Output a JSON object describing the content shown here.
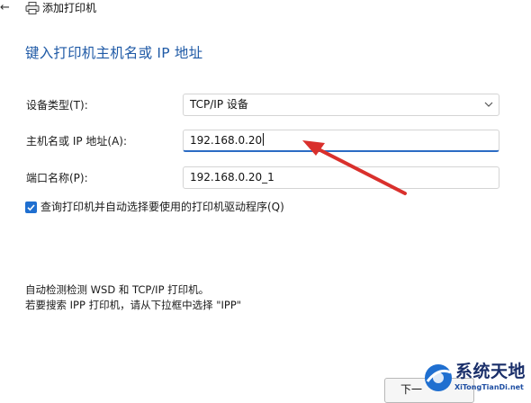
{
  "window": {
    "back_glyph": "←",
    "title": "添加打印机"
  },
  "heading": "键入打印机主机名或 IP 地址",
  "form": {
    "device_type": {
      "label": "设备类型(T):",
      "value": "TCP/IP 设备"
    },
    "hostname": {
      "label": "主机名或 IP 地址(A):",
      "value": "192.168.0.20"
    },
    "port_name": {
      "label": "端口名称(P):",
      "value": "192.168.0.20_1"
    },
    "query_printer": {
      "label": "查询打印机并自动选择要使用的打印机驱动程序(Q)",
      "checked": true
    }
  },
  "notes": {
    "line1": "自动检测检测 WSD 和 TCP/IP 打印机。",
    "line2": "若要搜索 IPP 打印机，请从下拉框中选择 \"IPP\""
  },
  "footer": {
    "next_label": "下一"
  },
  "watermark": {
    "name": "系统天地",
    "url": "XiTongTianDi.net"
  },
  "colors": {
    "accent": "#1f6fd0",
    "heading": "#1f5aa6",
    "annotation_arrow": "#d9302c"
  }
}
